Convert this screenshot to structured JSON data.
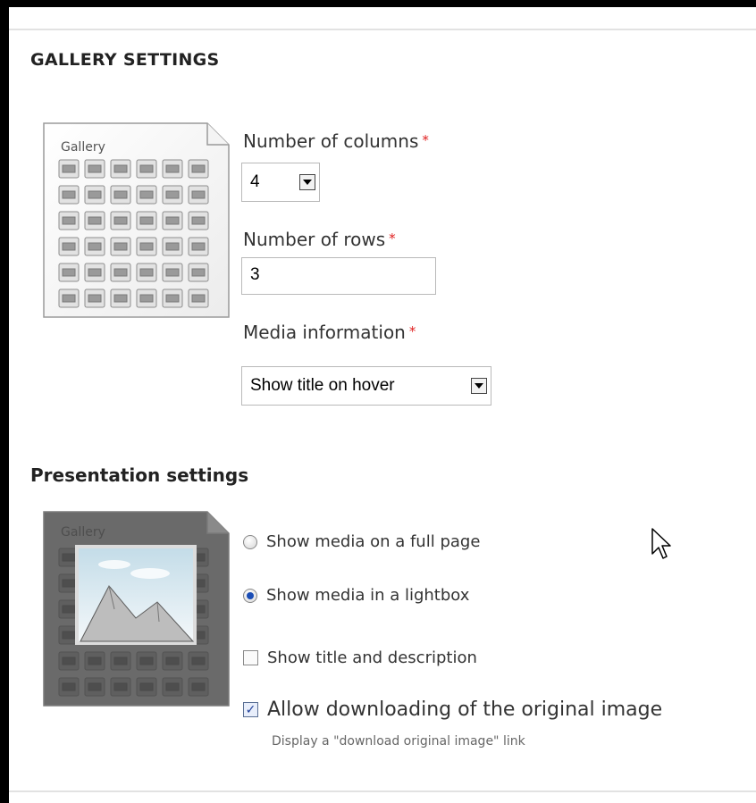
{
  "gallery_settings": {
    "title": "GALLERY SETTINGS",
    "preview_label": "Gallery",
    "columns": {
      "label": "Number of columns",
      "required_mark": "*",
      "value": "4"
    },
    "rows": {
      "label": "Number of rows",
      "required_mark": "*",
      "value": "3"
    },
    "media_info": {
      "label": "Media information",
      "required_mark": "*",
      "value": "Show title on hover"
    }
  },
  "presentation_settings": {
    "title": "Presentation settings",
    "preview_label": "Gallery",
    "options": [
      {
        "label": "Show media on a full page",
        "type": "radio",
        "checked": false
      },
      {
        "label": "Show media in a lightbox",
        "type": "radio",
        "checked": true
      },
      {
        "label": "Show title and description",
        "type": "checkbox",
        "checked": false
      },
      {
        "label": "Allow downloading of the original image",
        "type": "checkbox",
        "checked": true
      }
    ],
    "download_description": "Display a \"download original image\" link"
  },
  "colors": {
    "required": "#e02020",
    "radio_selected": "#1a4db5",
    "checkbox_tick": "#1f3f99"
  },
  "icons": [
    "gallery-grid-icon",
    "gallery-lightbox-icon",
    "dropdown-arrow-icon",
    "mouse-pointer-icon"
  ]
}
